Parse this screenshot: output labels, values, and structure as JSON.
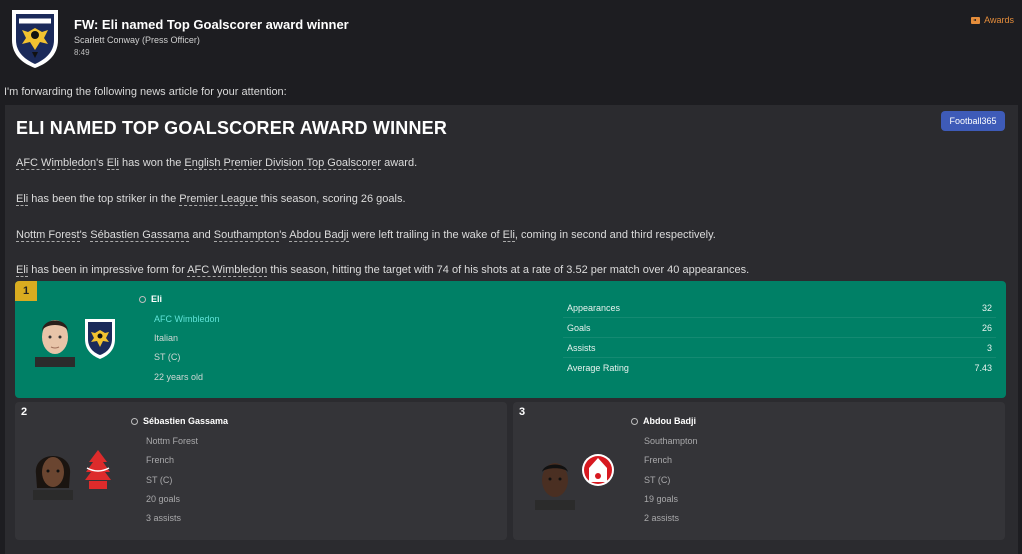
{
  "header": {
    "title": "FW: Eli named Top Goalscorer award winner",
    "sender": "Scarlett Conway  (Press Officer)",
    "time": "8:49",
    "awards_link": "Awards"
  },
  "intro": "I'm forwarding the following news article for your attention:",
  "article": {
    "headline": "ELI NAMED TOP GOALSCORER AWARD WINNER",
    "source": "Football365",
    "p1": {
      "club": "AFC Wimbledon",
      "t1": "'s ",
      "player": "Eli",
      "t2": " has won the ",
      "award": "English Premier Division Top Goalscorer",
      "t3": " award."
    },
    "p2": {
      "player": "Eli",
      "t1": " has been the top striker in the ",
      "league": "Premier League",
      "t2": " this season, scoring 26 goals."
    },
    "p3": {
      "club1": "Nottm Forest",
      "t1": "'s ",
      "player1": "Sébastien Gassama",
      "t2": " and ",
      "club2": "Southampton",
      "t3": "'s ",
      "player2": "Abdou Badji",
      "t4": " were left trailing in the wake of ",
      "player3": "Eli",
      "t5": ", coming in second and third respectively."
    },
    "p4": {
      "player": "Eli",
      "t1": " has been in impressive form for ",
      "club": "AFC Wimbledon",
      "t2": " this season, hitting the target with 74 of his shots at a rate of 3.52 per match over 40 appearances."
    }
  },
  "winner": {
    "rank": "1",
    "name": "Eli",
    "club": "AFC Wimbledon",
    "nationality": "Italian",
    "position": "ST (C)",
    "age": "22 years old",
    "stats": [
      {
        "label": "Appearances",
        "value": "32"
      },
      {
        "label": "Goals",
        "value": "26"
      },
      {
        "label": "Assists",
        "value": "3"
      },
      {
        "label": "Average Rating",
        "value": "7.43"
      }
    ]
  },
  "runners": [
    {
      "rank": "2",
      "name": "Sébastien Gassama",
      "club": "Nottm Forest",
      "nationality": "French",
      "position": "ST (C)",
      "goals": "20 goals",
      "assists": "3 assists"
    },
    {
      "rank": "3",
      "name": "Abdou Badji",
      "club": "Southampton",
      "nationality": "French",
      "position": "ST (C)",
      "goals": "19 goals",
      "assists": "2 assists"
    }
  ],
  "colors": {
    "winner_bg": "#008066",
    "gold": "#d9ac20",
    "source_button": "#3e5bb8",
    "awards_orange": "#e58d3b"
  }
}
